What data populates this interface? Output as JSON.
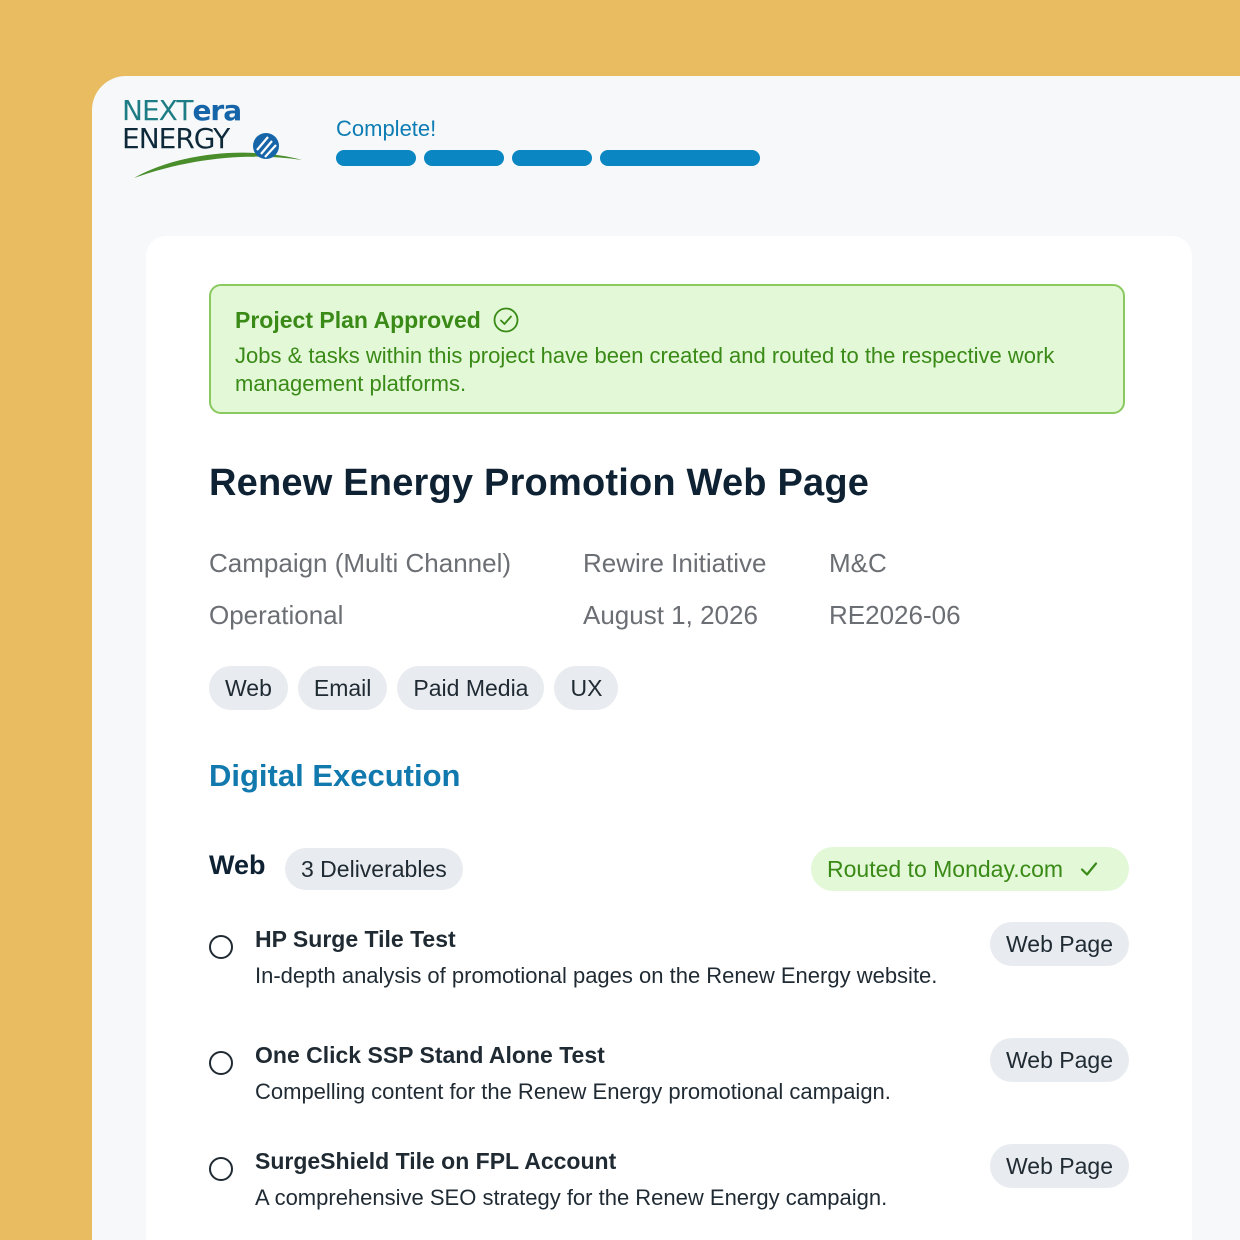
{
  "brand": {
    "logo_line1_a": "NEXT",
    "logo_line1_b": "era",
    "logo_line2": "ENERGY",
    "colors": {
      "teal": "#1E7C84",
      "blue": "#1565A8",
      "green": "#3A8A17"
    }
  },
  "progress": {
    "label": "Complete!",
    "segments": 4,
    "completed": 4,
    "color": "#0A86C2"
  },
  "alert": {
    "title": "Project Plan Approved",
    "icon": "check-circle-icon",
    "body": "Jobs & tasks within this project have been created and routed to the respective work management platforms."
  },
  "project": {
    "title": "Renew Energy Promotion Web Page",
    "meta": {
      "type": "Campaign (Multi Channel)",
      "initiative": "Rewire Initiative",
      "department": "M&C",
      "category": "Operational",
      "date": "August 1, 2026",
      "code": "RE2026-06"
    },
    "tags": [
      "Web",
      "Email",
      "Paid Media",
      "UX"
    ]
  },
  "section": {
    "title": "Digital Execution",
    "groups": [
      {
        "name": "Web",
        "count_label": "3 Deliverables",
        "status_label": "Routed to Monday.com",
        "status_icon": "checkmark-icon",
        "items": [
          {
            "title": "HP Surge Tile Test",
            "description": "In-depth analysis of promotional pages on the Renew Energy website.",
            "type": "Web Page"
          },
          {
            "title": "One Click SSP Stand Alone Test",
            "description": "Compelling content for the Renew Energy promotional campaign.",
            "type": "Web Page"
          },
          {
            "title": "SurgeShield Tile on FPL Account",
            "description": "A comprehensive SEO strategy for the Renew Energy campaign.",
            "type": "Web Page"
          }
        ]
      }
    ]
  }
}
